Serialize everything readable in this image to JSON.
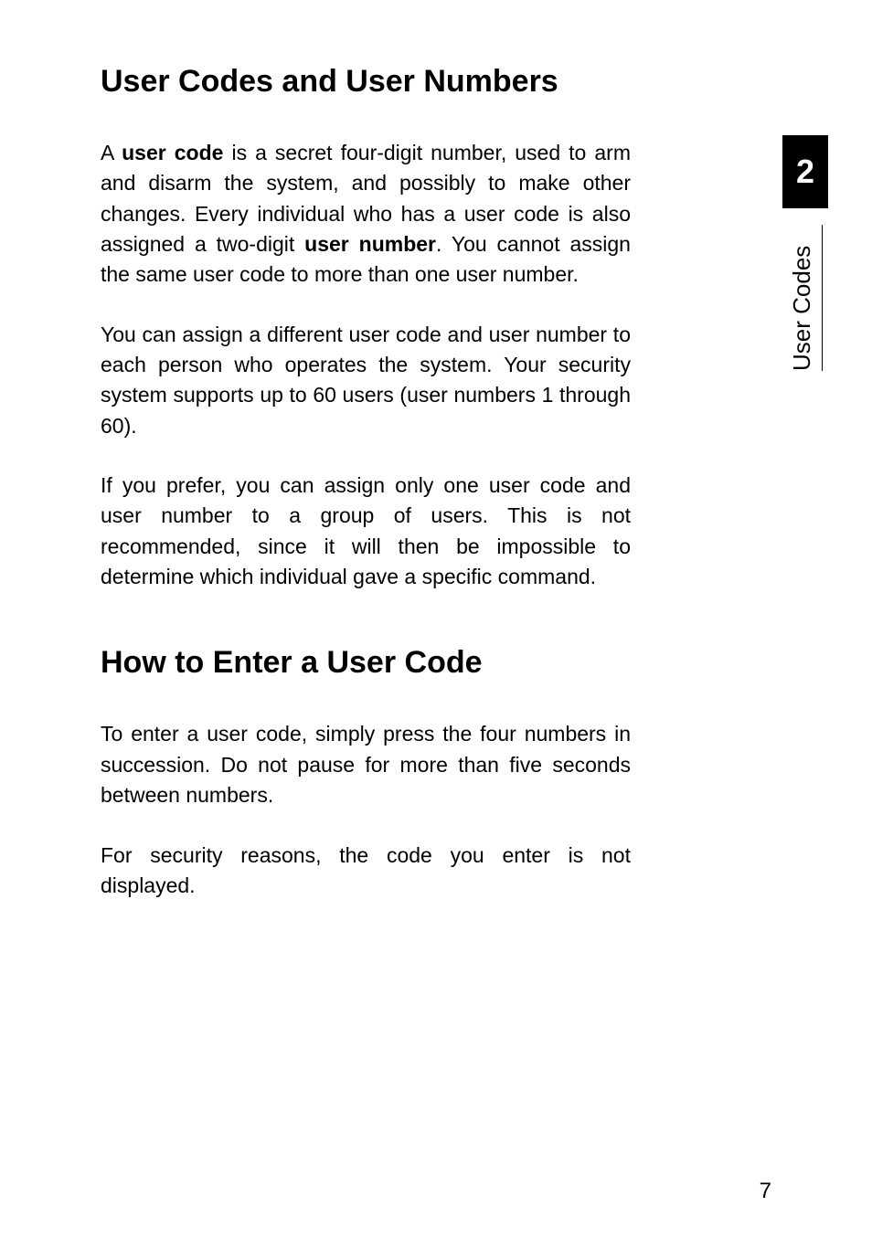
{
  "heading1": "User Codes and User Numbers",
  "para1_a": "A ",
  "para1_bold1": "user code",
  "para1_b": " is a secret four-digit number, used to arm and disarm the system, and possibly to make other changes.  Every individual who has a user code is also assigned a two-digit ",
  "para1_bold2": "user number",
  "para1_c": ".  You cannot assign the same user code to more than one user number.",
  "para2": "You can assign a different user code and user number to each person who operates the system.  Your security system supports up to 60 users (user numbers 1 through 60).",
  "para3": "If you prefer, you can assign only one user code and user number to a group of users.  This is not recommended, since it will then be impossible to determine which individual gave a specific command.",
  "heading2": "How to Enter a User Code",
  "para4": "To enter a user code, simply press the four numbers in succession.  Do not pause for more than five seconds between numbers.",
  "para5": "For security reasons, the code you enter is not displayed.",
  "tab_number": "2",
  "tab_label": "User Codes",
  "page_number": "7"
}
